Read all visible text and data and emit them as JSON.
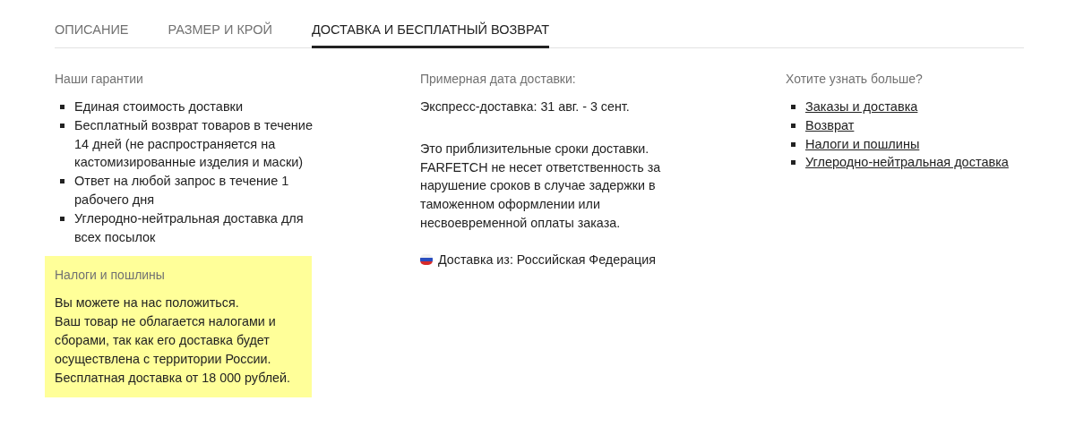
{
  "tabs": [
    {
      "label": "ОПИСАНИЕ",
      "selected": false
    },
    {
      "label": "РАЗМЕР И КРОЙ",
      "selected": false
    },
    {
      "label": "ДОСТАВКА И БЕСПЛАТНЫЙ ВОЗВРАТ",
      "selected": true
    }
  ],
  "guarantees": {
    "title": "Наши гарантии",
    "items": [
      "Единая стоимость доставки",
      "Бесплатный возврат товаров в течение 14 дней (не распространяется на кастомизированные изделия и маски)",
      "Ответ на любой запрос в течение 1 рабочего дня",
      "Углеродно-нейтральная доставка для всех посылок"
    ]
  },
  "taxes": {
    "title": "Налоги и пошлины",
    "paragraphs": [
      "Вы можете на нас положиться.",
      "Ваш товар не облагается налогами и сборами, так как его доставка будет осуществлена с территории России. Бесплатная доставка от 18 000 рублей."
    ]
  },
  "delivery": {
    "title": "Примерная дата доставки:",
    "express": "Экспресс-доставка: 31 авг. - 3 сент.",
    "note": "Это приблизительные сроки доставки. FARFETCH не несет ответственность за нарушение сроков в случае задержки в таможенном оформлении или несвоевременной оплаты заказа.",
    "origin": "Доставка из: Российская Федерация"
  },
  "more": {
    "title": "Хотите узнать больше?",
    "links": [
      "Заказы и доставка",
      "Возврат",
      "Налоги и пошлины",
      "Углеродно-нейтральная доставка"
    ]
  }
}
